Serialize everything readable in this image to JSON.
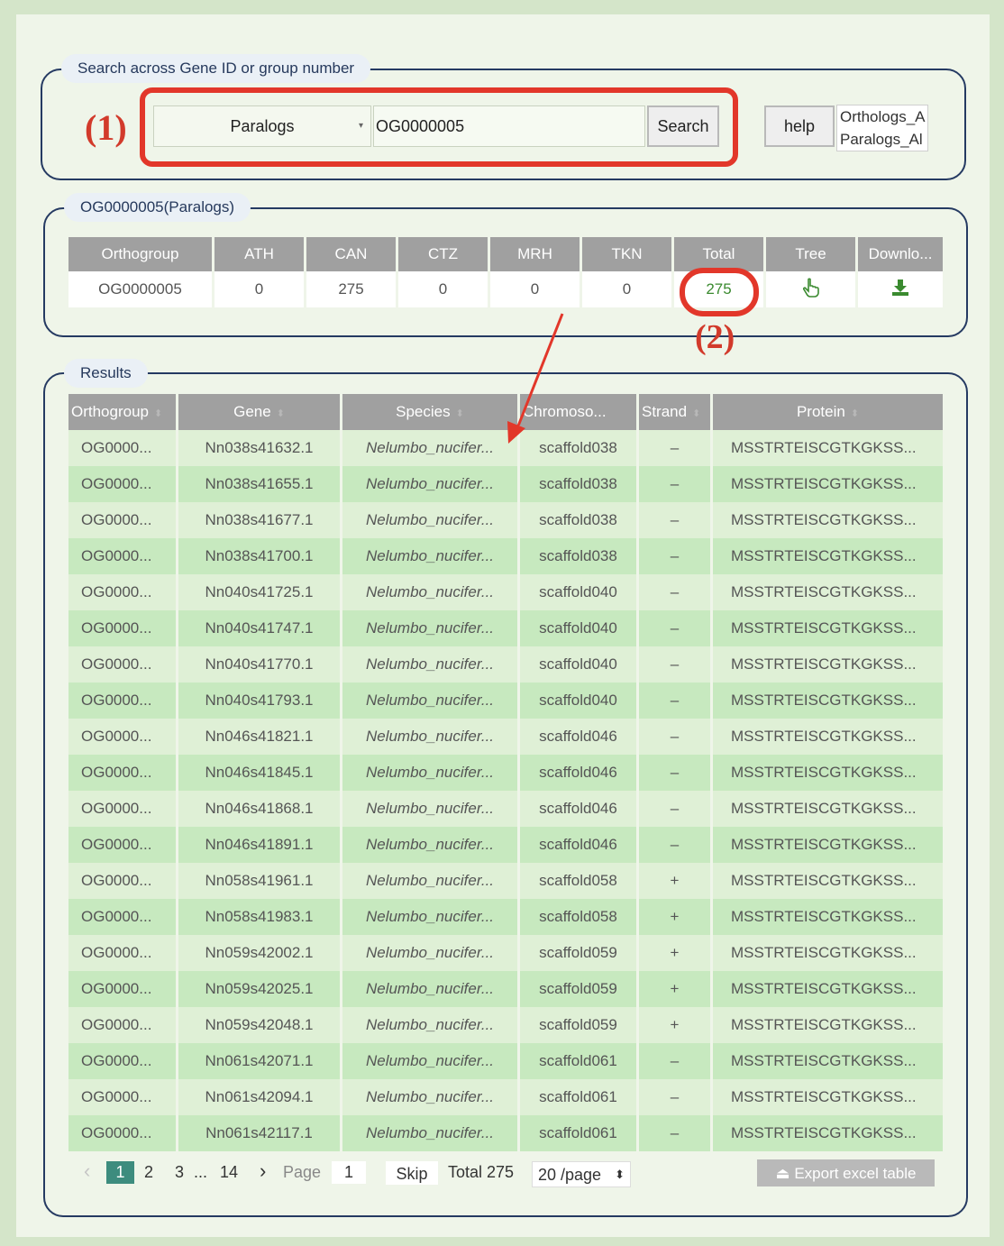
{
  "search_panel": {
    "legend": "Search across Gene ID or group number",
    "marker": "(1)",
    "type_select": "Paralogs",
    "query": "OG0000005",
    "search_label": "Search",
    "help_label": "help",
    "links": [
      "Orthologs_A",
      "Paralogs_Al"
    ]
  },
  "summary": {
    "legend": "OG0000005(Paralogs)",
    "marker": "(2)",
    "columns": [
      "Orthogroup",
      "ATH",
      "CAN",
      "CTZ",
      "MRH",
      "TKN",
      "Total",
      "Tree",
      "Downlo..."
    ],
    "row": {
      "orthogroup": "OG0000005",
      "ATH": "0",
      "CAN": "275",
      "CTZ": "0",
      "MRH": "0",
      "TKN": "0",
      "total": "275"
    }
  },
  "results": {
    "legend": "Results",
    "columns": [
      "Orthogroup",
      "Gene",
      "Species",
      "Chromoso...",
      "Strand",
      "Protein"
    ],
    "rows": [
      {
        "og": "OG0000...",
        "gene": "Nn038s41632.1",
        "species": "Nelumbo_nucifer...",
        "chrom": "scaffold038",
        "strand": "–",
        "protein": "MSSTRTEISCGTKGKSS..."
      },
      {
        "og": "OG0000...",
        "gene": "Nn038s41655.1",
        "species": "Nelumbo_nucifer...",
        "chrom": "scaffold038",
        "strand": "–",
        "protein": "MSSTRTEISCGTKGKSS..."
      },
      {
        "og": "OG0000...",
        "gene": "Nn038s41677.1",
        "species": "Nelumbo_nucifer...",
        "chrom": "scaffold038",
        "strand": "–",
        "protein": "MSSTRTEISCGTKGKSS..."
      },
      {
        "og": "OG0000...",
        "gene": "Nn038s41700.1",
        "species": "Nelumbo_nucifer...",
        "chrom": "scaffold038",
        "strand": "–",
        "protein": "MSSTRTEISCGTKGKSS..."
      },
      {
        "og": "OG0000...",
        "gene": "Nn040s41725.1",
        "species": "Nelumbo_nucifer...",
        "chrom": "scaffold040",
        "strand": "–",
        "protein": "MSSTRTEISCGTKGKSS..."
      },
      {
        "og": "OG0000...",
        "gene": "Nn040s41747.1",
        "species": "Nelumbo_nucifer...",
        "chrom": "scaffold040",
        "strand": "–",
        "protein": "MSSTRTEISCGTKGKSS..."
      },
      {
        "og": "OG0000...",
        "gene": "Nn040s41770.1",
        "species": "Nelumbo_nucifer...",
        "chrom": "scaffold040",
        "strand": "–",
        "protein": "MSSTRTEISCGTKGKSS..."
      },
      {
        "og": "OG0000...",
        "gene": "Nn040s41793.1",
        "species": "Nelumbo_nucifer...",
        "chrom": "scaffold040",
        "strand": "–",
        "protein": "MSSTRTEISCGTKGKSS..."
      },
      {
        "og": "OG0000...",
        "gene": "Nn046s41821.1",
        "species": "Nelumbo_nucifer...",
        "chrom": "scaffold046",
        "strand": "–",
        "protein": "MSSTRTEISCGTKGKSS..."
      },
      {
        "og": "OG0000...",
        "gene": "Nn046s41845.1",
        "species": "Nelumbo_nucifer...",
        "chrom": "scaffold046",
        "strand": "–",
        "protein": "MSSTRTEISCGTKGKSS..."
      },
      {
        "og": "OG0000...",
        "gene": "Nn046s41868.1",
        "species": "Nelumbo_nucifer...",
        "chrom": "scaffold046",
        "strand": "–",
        "protein": "MSSTRTEISCGTKGKSS..."
      },
      {
        "og": "OG0000...",
        "gene": "Nn046s41891.1",
        "species": "Nelumbo_nucifer...",
        "chrom": "scaffold046",
        "strand": "–",
        "protein": "MSSTRTEISCGTKGKSS..."
      },
      {
        "og": "OG0000...",
        "gene": "Nn058s41961.1",
        "species": "Nelumbo_nucifer...",
        "chrom": "scaffold058",
        "strand": "+",
        "protein": "MSSTRTEISCGTKGKSS..."
      },
      {
        "og": "OG0000...",
        "gene": "Nn058s41983.1",
        "species": "Nelumbo_nucifer...",
        "chrom": "scaffold058",
        "strand": "+",
        "protein": "MSSTRTEISCGTKGKSS..."
      },
      {
        "og": "OG0000...",
        "gene": "Nn059s42002.1",
        "species": "Nelumbo_nucifer...",
        "chrom": "scaffold059",
        "strand": "+",
        "protein": "MSSTRTEISCGTKGKSS..."
      },
      {
        "og": "OG0000...",
        "gene": "Nn059s42025.1",
        "species": "Nelumbo_nucifer...",
        "chrom": "scaffold059",
        "strand": "+",
        "protein": "MSSTRTEISCGTKGKSS..."
      },
      {
        "og": "OG0000...",
        "gene": "Nn059s42048.1",
        "species": "Nelumbo_nucifer...",
        "chrom": "scaffold059",
        "strand": "+",
        "protein": "MSSTRTEISCGTKGKSS..."
      },
      {
        "og": "OG0000...",
        "gene": "Nn061s42071.1",
        "species": "Nelumbo_nucifer...",
        "chrom": "scaffold061",
        "strand": "–",
        "protein": "MSSTRTEISCGTKGKSS..."
      },
      {
        "og": "OG0000...",
        "gene": "Nn061s42094.1",
        "species": "Nelumbo_nucifer...",
        "chrom": "scaffold061",
        "strand": "–",
        "protein": "MSSTRTEISCGTKGKSS..."
      },
      {
        "og": "OG0000...",
        "gene": "Nn061s42117.1",
        "species": "Nelumbo_nucifer...",
        "chrom": "scaffold061",
        "strand": "–",
        "protein": "MSSTRTEISCGTKGKSS..."
      }
    ]
  },
  "pagination": {
    "prev": "‹",
    "pages": [
      "1",
      "2",
      "3"
    ],
    "ellipsis": "...",
    "last_page": "14",
    "next": "›",
    "page_label": "Page",
    "page_input": "1",
    "skip_label": "Skip",
    "total_label": "Total 275",
    "page_size": "20 /page",
    "export_label": "Export excel table"
  },
  "colors": {
    "highlight_red": "#e2372a",
    "gene_green": "#3a8a2f",
    "frame_navy": "#253a62"
  },
  "icons": {
    "tree": "pointing-hand-icon",
    "download": "download-icon",
    "export": "export-icon"
  }
}
